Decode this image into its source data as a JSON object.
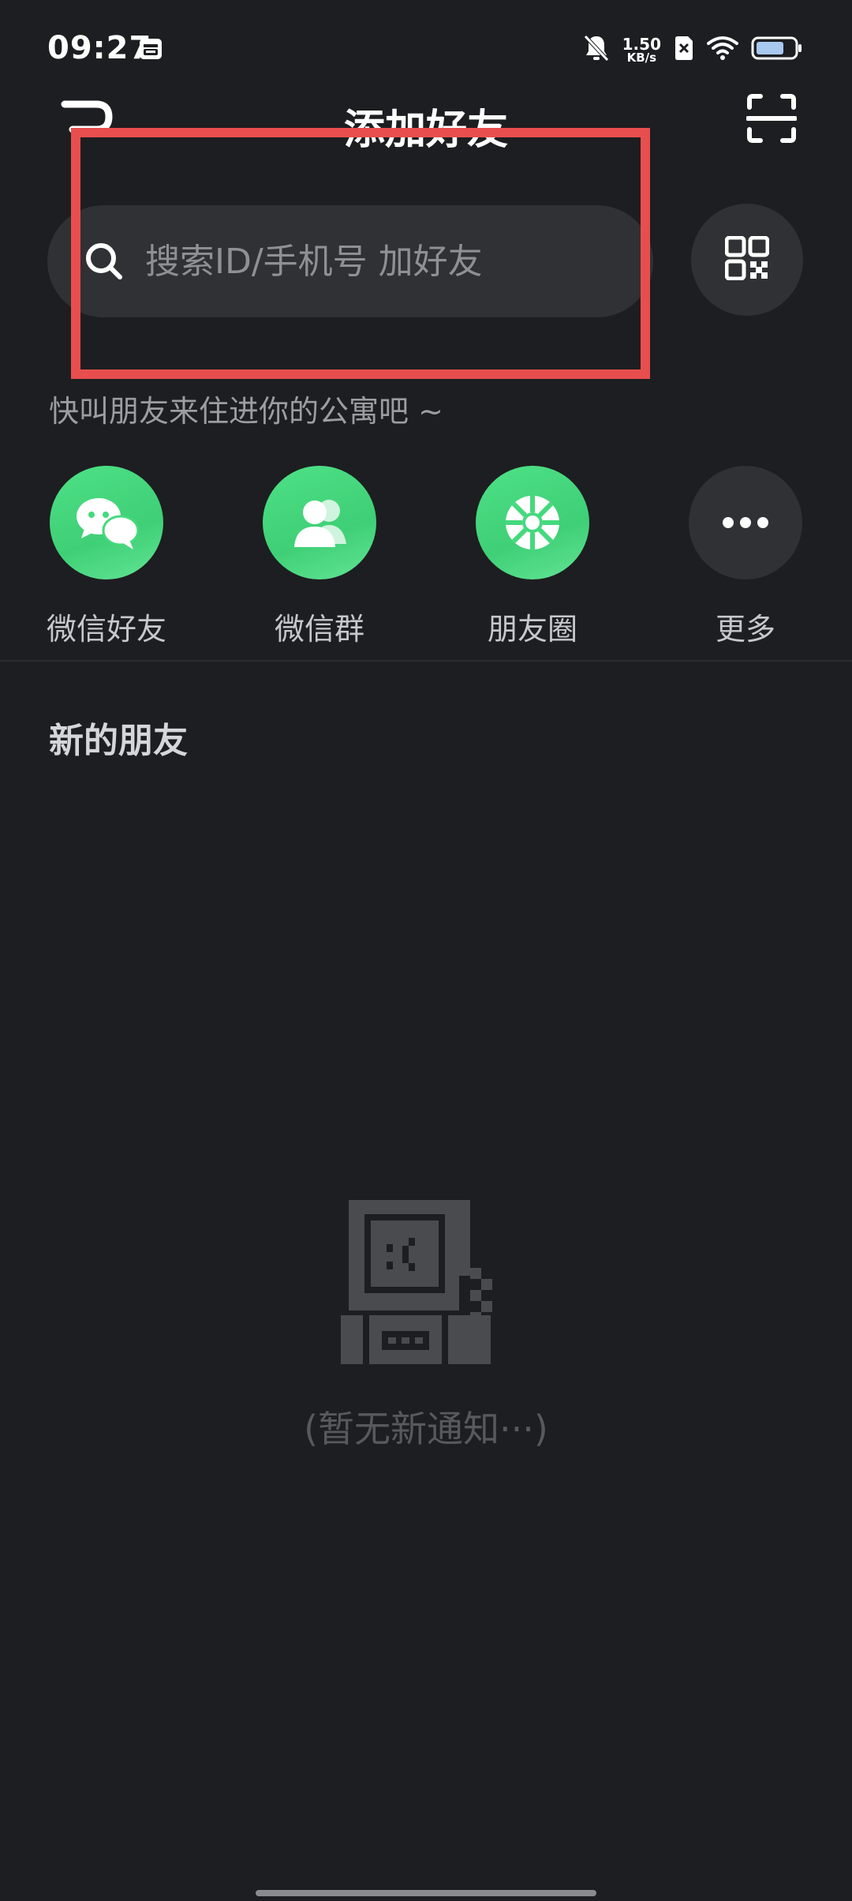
{
  "status_bar": {
    "time": "09:27",
    "net_speed_value": "1.50",
    "net_speed_unit": "KB/s",
    "icons": [
      "calendar-icon",
      "bell-muted-icon",
      "sim-off-icon",
      "wifi-icon",
      "battery-icon"
    ]
  },
  "header": {
    "title": "添加好友",
    "back_icon": "back-arrow-icon",
    "scan_icon": "scan-icon"
  },
  "search": {
    "placeholder": "搜索ID/手机号 加好友",
    "icon": "search-icon",
    "qr_icon": "qr-code-icon"
  },
  "invite": {
    "text": "快叫朋友来住进你的公寓吧 ~",
    "items": [
      {
        "label": "微信好友",
        "icon": "wechat-chat-icon"
      },
      {
        "label": "微信群",
        "icon": "wechat-group-icon"
      },
      {
        "label": "朋友圈",
        "icon": "moments-icon"
      },
      {
        "label": "更多",
        "icon": "more-icon"
      }
    ]
  },
  "new_friends": {
    "title": "新的朋友",
    "empty_text": "(暂无新通知···)"
  },
  "colors": {
    "background": "#1d1e21",
    "surface": "#303134",
    "accent_green": "#44d97d",
    "highlight_red": "#e84e4e"
  }
}
